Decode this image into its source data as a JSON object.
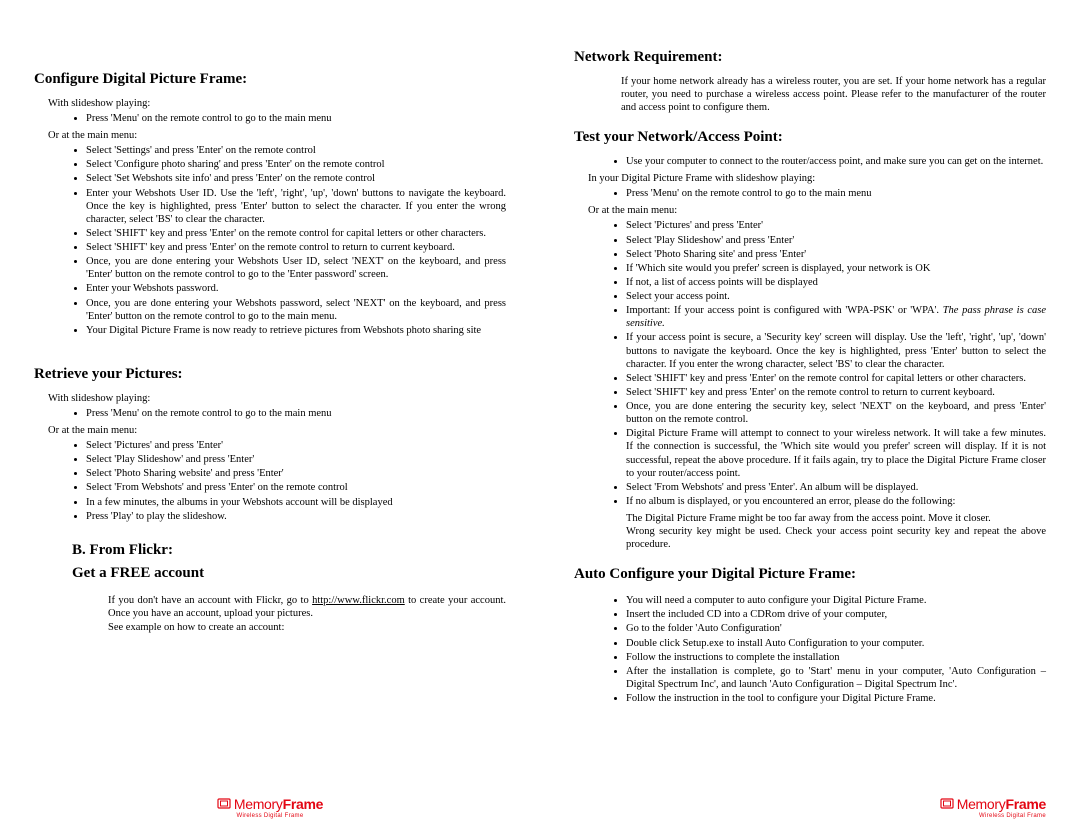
{
  "footer": {
    "brand_a": "Memory",
    "brand_b": "Frame",
    "tag": "Wireless Digital Frame"
  },
  "left": {
    "h_configure": "Configure Digital Picture Frame:",
    "cfg_lead": "With slideshow playing:",
    "cfg_b1": "Press 'Menu' on the remote control to go to the main menu",
    "cfg_or": "Or at the main menu:",
    "cfg_items": [
      "Select 'Settings' and press 'Enter' on the remote control",
      "Select 'Configure photo sharing' and press 'Enter' on the remote control",
      "Select 'Set Webshots site info' and press 'Enter' on the remote control",
      "Enter your Webshots User ID. Use the 'left', 'right', 'up', 'down' buttons to navigate the keyboard. Once the key is highlighted, press 'Enter' button to select the character. If you enter the wrong character, select 'BS' to clear the character.",
      "Select 'SHIFT' key and press 'Enter' on the remote control for capital letters or other characters.",
      "Select 'SHIFT' key and press 'Enter' on the remote control to return to current keyboard.",
      "Once, you are done entering your Webshots User ID, select 'NEXT' on the keyboard, and press 'Enter' button on the remote control to go to the 'Enter password' screen.",
      "Enter your Webshots password.",
      "Once, you are done entering your Webshots password, select 'NEXT' on the keyboard, and press 'Enter' button on the remote control to go to the main menu.",
      "Your Digital Picture Frame is now ready to retrieve pictures from Webshots photo sharing site"
    ],
    "h_retrieve": "Retrieve your Pictures:",
    "ret_lead": "With slideshow playing:",
    "ret_b1": "Press 'Menu' on the remote control to go to the main menu",
    "ret_or": "Or at the main menu:",
    "ret_items": [
      "Select 'Pictures' and press 'Enter'",
      "Select 'Play Slideshow' and press 'Enter'",
      "Select 'Photo Sharing website' and press 'Enter'",
      "Select 'From Webshots' and press 'Enter' on the remote control",
      "In a few minutes, the albums in your Webshots account will be displayed",
      "Press 'Play' to play the slideshow."
    ],
    "h_flickr_a": "B.  From Flickr:",
    "h_flickr_b": "Get a FREE account",
    "flickr_p1a": "If you don't have an account with Flickr, go to ",
    "flickr_link": "http://www.flickr.com",
    "flickr_p1b": " to create your account. Once you have an account, upload your pictures.",
    "flickr_p2": "See example on how to create an account:"
  },
  "right": {
    "h_netreq": "Network Requirement:",
    "netreq_body": "If your home network already has a wireless router, you are set. If your home network has a regular router, you need to purchase a wireless access point. Please refer to the manufacturer of the router and access point to configure them.",
    "h_test": "Test your Network/Access Point:",
    "test_b1": "Use your computer to connect to the router/access point, and make sure you can get on the internet.",
    "test_lead2": "In your Digital Picture Frame with slideshow playing:",
    "test_b2": "Press 'Menu' on the remote control to go to the main menu",
    "test_or": "Or at the main menu:",
    "test_items": [
      "Select 'Pictures' and press 'Enter'",
      "Select 'Play Slideshow' and press 'Enter'",
      "Select 'Photo Sharing site' and press 'Enter'",
      "If 'Which site would you prefer' screen is displayed, your network is OK",
      "If not, a list of access points will be displayed",
      "Select your access point."
    ],
    "test_important_a": "Important: If your access point is configured with 'WPA-PSK' or 'WPA'. ",
    "test_important_b": "The pass phrase is case sensitive.",
    "test_items2": [
      "If your access point is secure, a 'Security key' screen will display. Use the 'left', 'right', 'up', 'down' buttons to navigate the keyboard. Once the key is highlighted, press 'Enter' button to select the character. If you enter the wrong character, select 'BS' to clear the character.",
      "Select 'SHIFT' key and press 'Enter' on the remote control for capital letters or other characters.",
      "Select 'SHIFT' key and press 'Enter' on the remote control to return to current keyboard.",
      "Once, you are done entering the security key, select 'NEXT' on the keyboard, and press 'Enter' button on the remote control.",
      "Digital Picture Frame will attempt to connect to your wireless network. It will take a few minutes. If the connection is successful, the 'Which site would you prefer' screen will display. If it is not successful, repeat the above procedure. If it fails again, try to place the Digital Picture Frame closer to your router/access point.",
      "Select 'From Webshots' and press 'Enter'. An album will be displayed.",
      "If no album is displayed, or you encountered an error, please do the following:"
    ],
    "test_tail1": "The Digital Picture Frame might be too far away from the access point. Move it closer.",
    "test_tail2": "Wrong security key might be used. Check your access point security key and repeat the above procedure.",
    "h_auto": "Auto Configure your Digital Picture Frame:",
    "auto_items": [
      "You will need a computer to auto configure your Digital Picture Frame.",
      "Insert the included CD into a CDRom drive of your computer,",
      "Go to the folder 'Auto Configuration'",
      "Double click Setup.exe to install Auto Configuration to your computer.",
      "Follow the instructions to complete the installation",
      "After the installation is complete, go to 'Start' menu in your computer, 'Auto Configuration – Digital Spectrum Inc', and launch 'Auto Configuration – Digital Spectrum Inc'.",
      "Follow the instruction in the tool to configure your Digital Picture Frame."
    ]
  }
}
